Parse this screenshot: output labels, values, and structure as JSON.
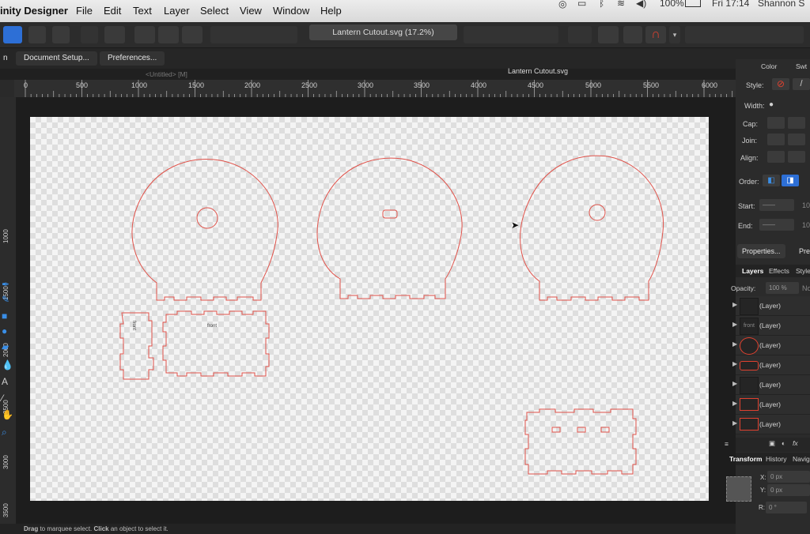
{
  "menubar": {
    "app_name": "inity Designer",
    "items": [
      "File",
      "Edit",
      "Text",
      "Layer",
      "Select",
      "View",
      "Window",
      "Help"
    ],
    "battery": "100%",
    "clock": "Fri 17:14",
    "user": "Shannon S"
  },
  "toolbar": {
    "document_title": "Lantern Cutout.svg (17.2%)"
  },
  "context": {
    "left_label": "n",
    "document_setup": "Document Setup...",
    "preferences": "Preferences..."
  },
  "tabs": {
    "untitled": "<Untitled> [M]",
    "lantern": "Lantern Cutout.svg"
  },
  "ruler": {
    "h_labels": [
      "0",
      "500",
      "1000",
      "1500",
      "2000",
      "2500",
      "3000",
      "3500",
      "4000",
      "4500",
      "5000",
      "5500",
      "6000"
    ],
    "v_labels": [
      "1000",
      "1500",
      "2000",
      "2500",
      "3000",
      "3500"
    ]
  },
  "artboard": {
    "part_label_1": "front",
    "part_label_2": "front"
  },
  "status": {
    "drag": "Drag",
    "text1": " to marquee select. ",
    "click": "Click",
    "text2": " an object to select it."
  },
  "panel": {
    "tab_color": "Color",
    "tab_swatches": "Swt",
    "style_label": "Style:",
    "width_label": "Width:",
    "cap_label": "Cap:",
    "join_label": "Join:",
    "align_label": "Align:",
    "order_label": "Order:",
    "start_label": "Start:",
    "end_label": "End:",
    "start_value": "10",
    "end_value": "10",
    "properties_button": "Properties...",
    "pre_button": "Pre",
    "layers_tabs": [
      "Layers",
      "Effects",
      "Style"
    ],
    "opacity_label": "Opacity:",
    "opacity_value": "100 %",
    "blend_partial": "No",
    "layers": [
      "(Layer)",
      "(Layer)",
      "(Layer)",
      "(Layer)",
      "(Layer)",
      "(Layer)",
      "(Layer)"
    ],
    "front_thumb_text": "front",
    "fx_label": "fx",
    "transform_tabs": [
      "Transform",
      "History",
      "Navig"
    ],
    "x_label": "X:",
    "x_value": "0 px",
    "y_label": "Y:",
    "y_value": "0 px",
    "r_label": "R:",
    "r_value": "0 °"
  },
  "colors": {
    "cut_line": "#e0524a",
    "accent_blue": "#2d6fd6"
  }
}
